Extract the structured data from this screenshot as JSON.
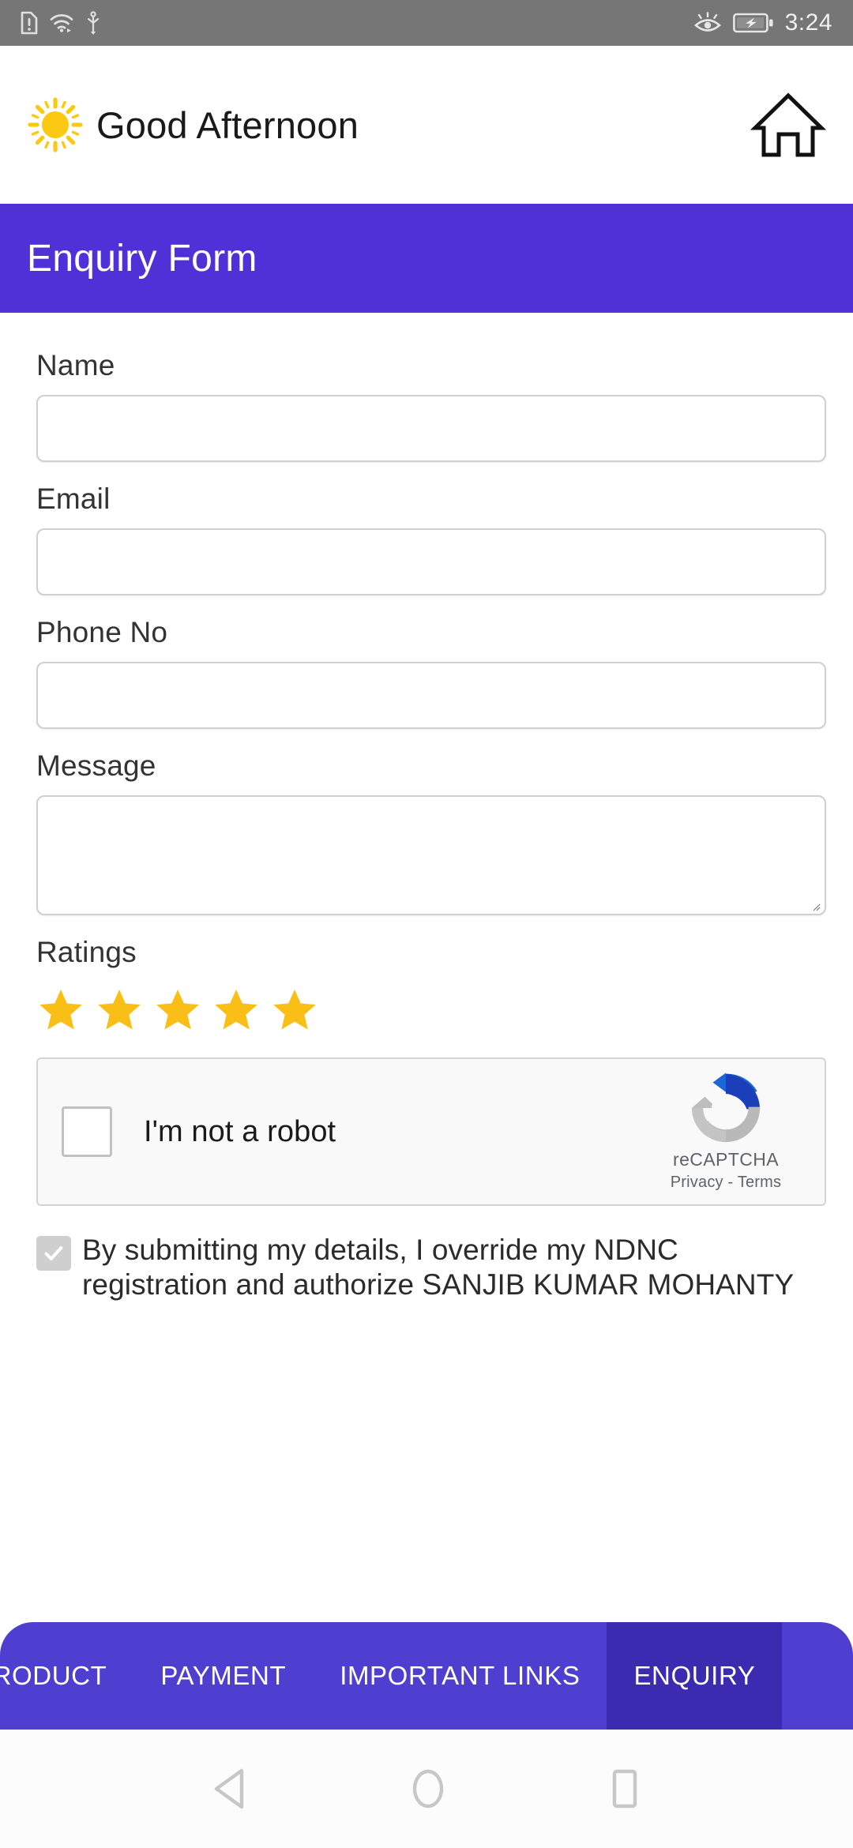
{
  "status_bar": {
    "icons_left": [
      "sim-alert-icon",
      "wifi-icon",
      "usb-icon"
    ],
    "icons_right": [
      "eye-comfort-icon",
      "battery-charging-icon"
    ],
    "time": "3:24"
  },
  "header": {
    "greeting": "Good Afternoon",
    "sun_icon": "sun-icon",
    "home_icon": "home-icon"
  },
  "banner": {
    "title": "Enquiry Form",
    "color": "#4F31D8"
  },
  "form": {
    "fields": [
      {
        "label": "Name",
        "value": "",
        "placeholder": "",
        "type": "text"
      },
      {
        "label": "Email",
        "value": "",
        "placeholder": "",
        "type": "text"
      },
      {
        "label": "Phone No",
        "value": "",
        "placeholder": "",
        "type": "text"
      },
      {
        "label": "Message",
        "value": "",
        "placeholder": "",
        "type": "textarea"
      }
    ],
    "ratings": {
      "label": "Ratings",
      "star_count": 5,
      "selected": 5,
      "star_color": "#F9BF16"
    },
    "recaptcha": {
      "checkbox_checked": false,
      "label": "I'm not a robot",
      "brand": "reCAPTCHA",
      "privacy": "Privacy",
      "separator": "-",
      "terms": "Terms",
      "logo_icon": "recaptcha-icon"
    },
    "consent": {
      "checked": true,
      "text": "By submitting my details, I override my NDNC registration and authorize SANJIB KUMAR MOHANTY"
    }
  },
  "tabbar": {
    "active_color": "#3B2BB0",
    "base_color": "#4F3FD0",
    "tabs": [
      {
        "label": "PRODUCT",
        "active": false
      },
      {
        "label": "PAYMENT",
        "active": false
      },
      {
        "label": "IMPORTANT LINKS",
        "active": false
      },
      {
        "label": "ENQUIRY",
        "active": true
      }
    ]
  },
  "navbar": {
    "back_icon": "back-triangle-icon",
    "home_icon": "home-circle-icon",
    "recents_icon": "recents-square-icon"
  }
}
